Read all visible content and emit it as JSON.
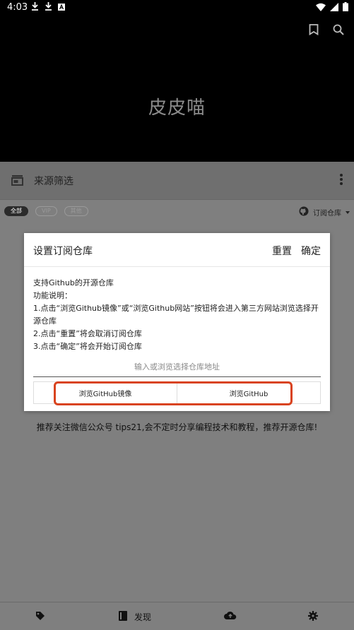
{
  "status_bar": {
    "time": "4:03"
  },
  "header": {
    "app_title": "皮皮喵"
  },
  "toolbar": {
    "label": "来源筛选"
  },
  "filters": {
    "chips": [
      "全部",
      "VIP",
      "其他"
    ]
  },
  "repo_link": {
    "label": "订阅仓库"
  },
  "dialog": {
    "title": "设置订阅仓库",
    "reset_label": "重置",
    "confirm_label": "确定",
    "description": [
      "支持Github的开源仓库",
      "功能说明：",
      "1.点击“浏览Github镜像”或“浏览Github网站”按钮将会进入第三方网站浏览选择开源仓库",
      "2.点击“重置”将会取消订阅仓库",
      "3.点击“确定”将会开始订阅仓库"
    ],
    "input_placeholder": "输入或浏览选择仓库地址",
    "btn_mirror": "浏览GitHub镜像",
    "btn_github": "浏览GitHub"
  },
  "recommend_text": "推荐关注微信公众号 tips21,会不定时分享编程技术和教程，推荐开源仓库!",
  "bottom_nav": {
    "discover_label": "发现"
  },
  "colors": {
    "highlight": "#d9431e",
    "header_bg": "#000000",
    "scrim": "#7f7f7f"
  },
  "icons": [
    "download-icon",
    "download-icon",
    "a-icon",
    "wifi-icon",
    "signal-icon",
    "battery-icon",
    "bookmark-icon",
    "search-icon",
    "store-icon",
    "more-vert-icon",
    "github-icon",
    "caret-down-icon",
    "tag-icon",
    "book-icon",
    "cloud-upload-icon",
    "gear-icon"
  ]
}
